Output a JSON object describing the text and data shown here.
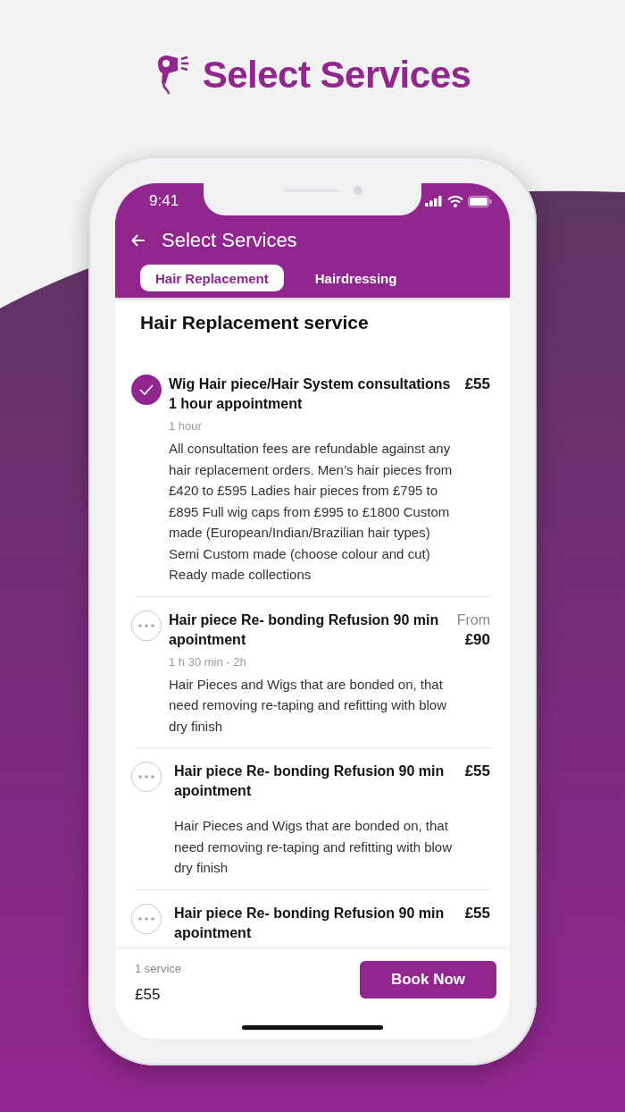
{
  "headline": {
    "title": "Select Services"
  },
  "status_bar": {
    "time": "9:41"
  },
  "app_bar": {
    "title": "Select Services"
  },
  "tabs": [
    {
      "label": "Hair Replacement",
      "selected": true
    },
    {
      "label": "Hairdressing",
      "selected": false
    }
  ],
  "section_title": "Hair Replacement service",
  "services": [
    {
      "title": "Wig Hair piece/Hair System consultations 1 hour appointment",
      "price": "£55",
      "duration": "1 hour",
      "description": "All consultation fees are refundable against any hair replacement orders. Men’s hair pieces from £420 to £595 Ladies hair pieces from £795 to £895 Full wig caps from £995 to £1800 Custom made (European/Indian/Brazilian hair types) Semi Custom made (choose colour and cut) Ready made collections",
      "selected": true
    },
    {
      "title": "Hair piece Re- bonding Refusion 90 min apointment",
      "price_prefix": "From",
      "price": "£90",
      "duration": "1 h 30 min - 2h",
      "description": "Hair Pieces and Wigs that are bonded on, that need removing re-taping and refitting with blow dry finish",
      "selected": false
    },
    {
      "title": "Hair piece Re- bonding Refusion 90 min apointment",
      "price": "£55",
      "description": "Hair Pieces and Wigs that are bonded on, that need removing re-taping and refitting with blow dry finish",
      "selected": false
    },
    {
      "title": "Hair piece Re- bonding Refusion 90 min apointment",
      "price": "£55",
      "selected": false
    }
  ],
  "footer": {
    "count": "1 service",
    "total": "£55",
    "button": "Book Now"
  }
}
